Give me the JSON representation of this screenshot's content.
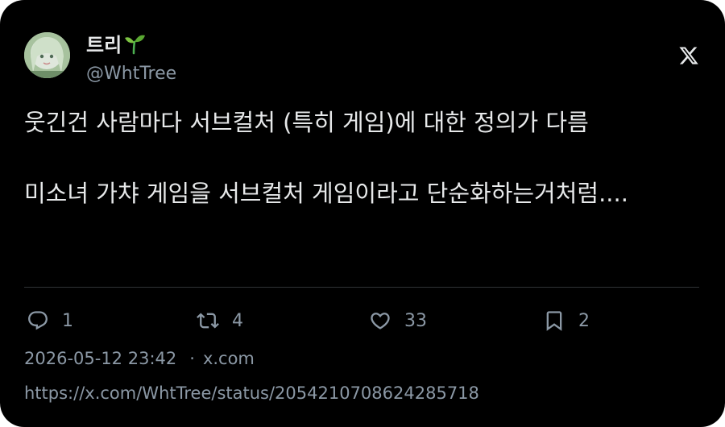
{
  "author": {
    "display_name": "트리",
    "name_emoji": "sprout-icon",
    "handle": "@WhtTree"
  },
  "tweet": {
    "text": "웃긴건 사람마다 서브컬처 (특히 게임)에 대한 정의가 다름\n\n미소녀 가챠 게임을 서브컬처 게임이라고 단순화하는거처럼...."
  },
  "actions": {
    "replies": "1",
    "retweets": "4",
    "likes": "33",
    "bookmarks": "2"
  },
  "meta": {
    "timestamp": "2026-05-12 23:42",
    "separator": "·",
    "source": "x.com"
  },
  "url": "https://x.com/WhtTree/status/2054210708624285718",
  "colors": {
    "background": "#000000",
    "text": "#e7e9ea",
    "muted": "#8b98a5",
    "divider": "#2f3336"
  }
}
